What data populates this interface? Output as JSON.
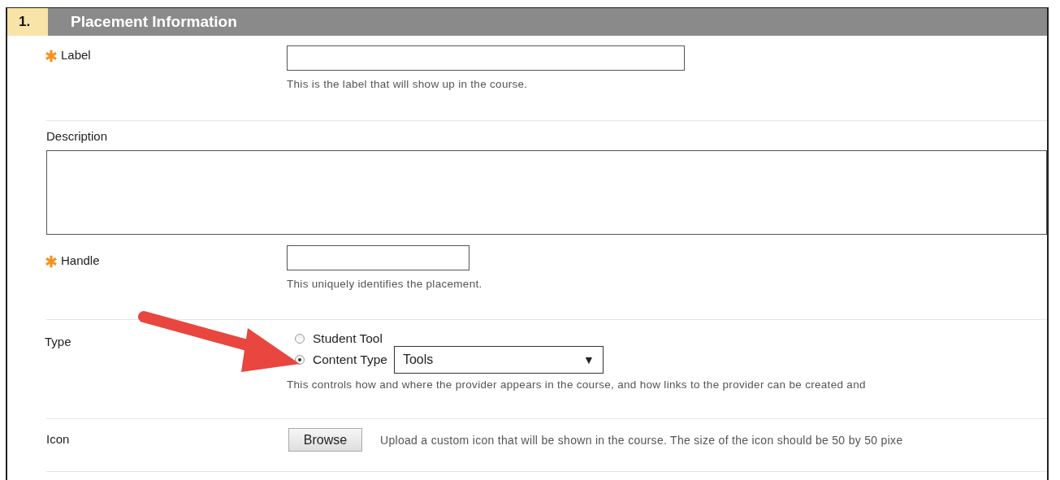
{
  "section": {
    "number": "1.",
    "title": "Placement Information"
  },
  "fields": [
    {
      "kind": "text",
      "label": "Label",
      "required": true,
      "hint": "This is the label that will show up in the course."
    },
    {
      "kind": "textarea",
      "label": "Description",
      "required": false
    },
    {
      "kind": "text",
      "label": "Handle",
      "required": true,
      "hint": "This uniquely identifies the placement."
    },
    {
      "kind": "radio",
      "label": "Type",
      "required": false,
      "options": [
        {
          "label": "Student Tool",
          "selected": false
        },
        {
          "label": "Content Type",
          "selected": true,
          "select": "Tools",
          "caret": "▼"
        }
      ],
      "hint": "This controls how and where the provider appears in the course, and how links to the provider can be created and"
    },
    {
      "kind": "file",
      "label": "Icon",
      "required": false,
      "button": "Browse",
      "hint": "Upload a custom icon that will be shown in the course. The size of the icon should be 50 by 50 pixe"
    }
  ]
}
